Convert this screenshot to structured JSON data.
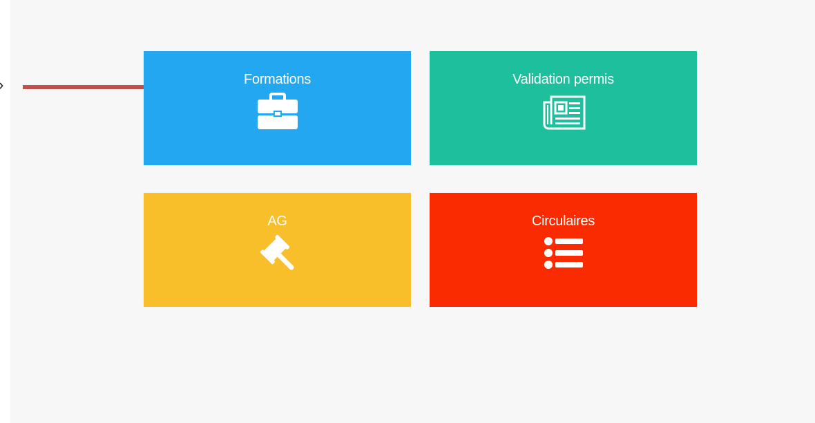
{
  "side": {
    "chevron": "›"
  },
  "tiles": [
    {
      "label": "Formations",
      "color": "#23a7f1",
      "icon": "briefcase-icon"
    },
    {
      "label": "Validation permis",
      "color": "#1dbf9c",
      "icon": "newspaper-icon"
    },
    {
      "label": "AG",
      "color": "#f8bf2b",
      "icon": "gavel-icon"
    },
    {
      "label": "Circulaires",
      "color": "#fa2b00",
      "icon": "list-icon"
    }
  ],
  "annotation": {
    "arrow_color": "#c0504d"
  }
}
